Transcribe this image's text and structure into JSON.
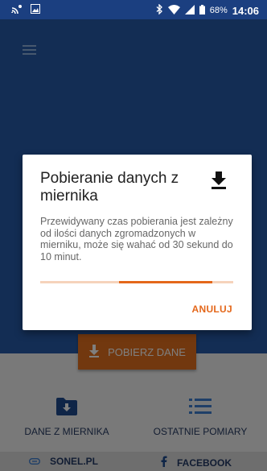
{
  "status_bar": {
    "battery": "68%",
    "time": "14:06",
    "icons": [
      "cast-icon",
      "image-icon",
      "bluetooth-icon",
      "wifi-icon",
      "signal-icon",
      "battery-icon"
    ]
  },
  "app": {
    "download_button_label": "POBIERZ DANE",
    "tiles": [
      {
        "label": "DANE Z MIERNIKA",
        "icon": "folder-download-icon"
      },
      {
        "label": "OSTATNIE POMIARY",
        "icon": "list-icon"
      }
    ],
    "footer": [
      {
        "label": "SONEL.PL",
        "icon": "link-icon"
      },
      {
        "label": "FACEBOOK",
        "icon": "facebook-icon"
      }
    ]
  },
  "dialog": {
    "title": "Pobieranie danych z miernika",
    "body": "Przewidywany czas pobierania jest zależny od ilości danych zgromadzonych w mierniku, może się wahać od 30 sekund do 10 minut.",
    "progress": "indeterminate",
    "cancel_label": "ANULUJ",
    "icon": "download-icon"
  },
  "colors": {
    "primary": "#265ba8",
    "accent": "#e4671a"
  }
}
